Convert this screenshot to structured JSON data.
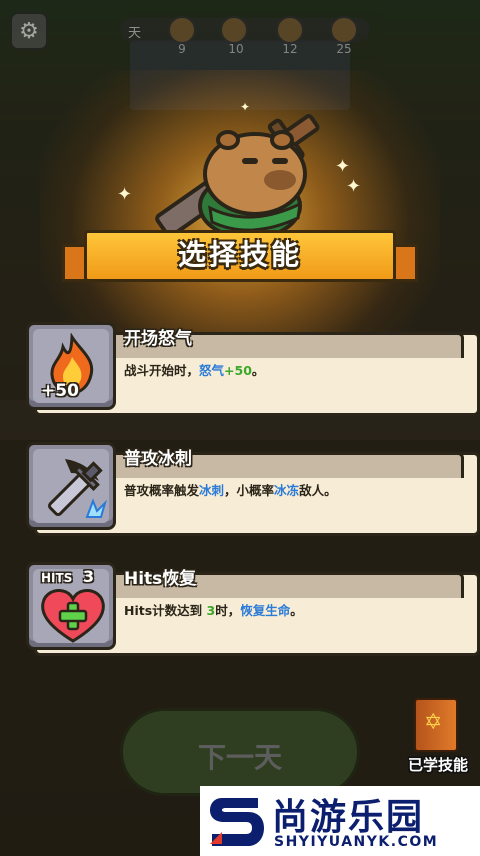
{
  "topbar": {
    "settings_icon": "gear-icon",
    "day_label": "天",
    "milestones": [
      "9",
      "10",
      "12",
      "25"
    ]
  },
  "banner": {
    "title": "选择技能"
  },
  "skills": [
    {
      "name": "开场怒气",
      "icon": "fire-icon",
      "icon_value": "+50",
      "desc_pre": "战斗开始时，",
      "desc_hl1": "怒气",
      "desc_mid": "+",
      "desc_hl2": "50",
      "desc_post": "。"
    },
    {
      "name": "普攻冰刺",
      "icon": "ice-sword-icon",
      "desc_pre": "普攻概率触发",
      "desc_hl1": "冰刺",
      "desc_mid": "，小概率",
      "desc_hl2": "冰冻",
      "desc_post": "敌人。"
    },
    {
      "name": "Hits恢复",
      "icon": "heart-plus-icon",
      "icon_badge": "HITS",
      "icon_badge_num": "3",
      "desc_pre": "Hits计数达到 ",
      "desc_hl1": "3",
      "desc_mid": "时，",
      "desc_hl2": "恢复生命",
      "desc_post": "。"
    }
  ],
  "next_button": {
    "label": "下一天"
  },
  "learned_skills": {
    "label": "已学技能",
    "icon": "book-icon"
  },
  "watermark": {
    "name": "尚游乐园",
    "url": "SHYIYUANYK.COM"
  },
  "colors": {
    "accent": "#f7b42c",
    "card_bg": "#f7ecd6",
    "green": "#3aa82a",
    "blue": "#2a7ad8"
  }
}
